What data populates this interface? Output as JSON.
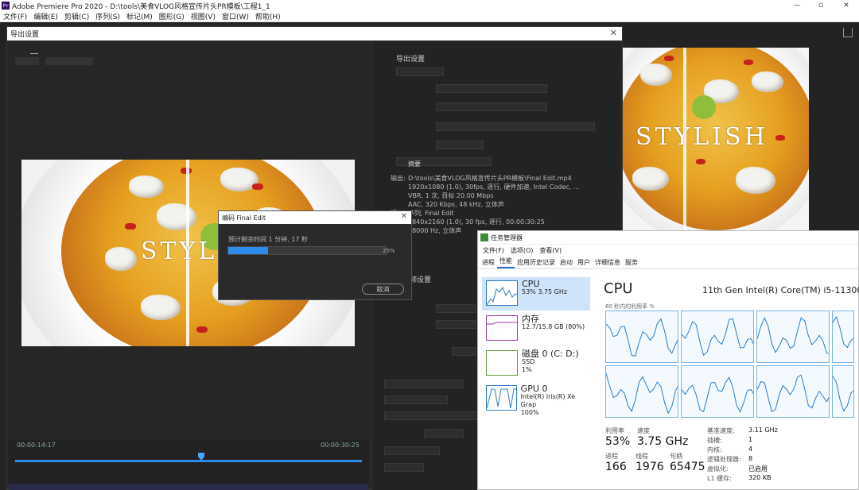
{
  "premiere": {
    "title": "Adobe Premiere Pro 2020 - D:\\tools\\美食VLOG风格宣传片头PR模板\\工程1_1",
    "menu": [
      "文件(F)",
      "编辑(E)",
      "剪辑(C)",
      "序列(S)",
      "标记(M)",
      "图形(G)",
      "视图(V)",
      "窗口(W)",
      "帮助(H)"
    ]
  },
  "export_dialog": {
    "title": "导出设置",
    "settings_title": "导出设置",
    "summary_label": "摘要",
    "output_label": "输出:",
    "output_lines": [
      "D:\\tools\\美食VLOG风格宣传片头PR模板\\Final Edit.mp4",
      "1920x1080 (1.0), 30fps, 逐行, 硬件加速, Intel Codec, ...",
      "VBR, 1 次, 目标 20.00 Mbps",
      "AAC, 320 Kbps, 48 kHz, 立体声"
    ],
    "source_label": "源:",
    "source_lines": [
      "序列, Final Edit",
      "3840x2160 (1.0), 30 fps, 逐行, 00:00:30:25",
      "48000 Hz, 立体声"
    ],
    "video_settings_title": "视频设置",
    "timecode_in": "00:00:14:17",
    "timecode_out": "00:00:30:25",
    "overlay_text": "STYLISH"
  },
  "encoding": {
    "title": "编码 Final Edit",
    "remaining": "预计剩余时间 1 分钟, 17 秒",
    "progress": 25,
    "progress_label": "25%",
    "cancel_label": "取消"
  },
  "task_manager": {
    "title": "任务管理器",
    "menu": [
      "文件(F)",
      "选项(O)",
      "查看(V)"
    ],
    "tabs": [
      "进程",
      "性能",
      "应用历史记录",
      "启动",
      "用户",
      "详细信息",
      "服务"
    ],
    "active_tab": "性能",
    "sidebar": [
      {
        "name": "CPU",
        "sub1": "53% 3.75 GHz",
        "sub2": ""
      },
      {
        "name": "内存",
        "sub1": "12.7/15.8 GB (80%)",
        "sub2": ""
      },
      {
        "name": "磁盘 0 (C: D:)",
        "sub1": "SSD",
        "sub2": "1%"
      },
      {
        "name": "GPU 0",
        "sub1": "Intel(R) Iris(R) Xe Grap",
        "sub2": "100%"
      }
    ],
    "cpu_title": "CPU",
    "cpu_model": "11th Gen Intel(R) Core(TM) i5-11300H",
    "graph_caption": "60 秒内的利用率 %",
    "stats": {
      "util_label": "利用率",
      "util_value": "53%",
      "speed_label": "速度",
      "speed_value": "3.75 GHz",
      "proc_label": "进程",
      "proc_value": "166",
      "thread_label": "线程",
      "thread_value": "1976",
      "handle_label": "句柄",
      "handle_value": "65475"
    },
    "kv": [
      {
        "k": "基准速度:",
        "v": "3.11 GHz"
      },
      {
        "k": "插槽:",
        "v": "1"
      },
      {
        "k": "内核:",
        "v": "4"
      },
      {
        "k": "逻辑处理器:",
        "v": "8"
      },
      {
        "k": "虚拟化:",
        "v": "已启用"
      },
      {
        "k": "L1 缓存:",
        "v": "320 KB"
      }
    ]
  },
  "colors": {
    "accent": "#2d8ceb",
    "dark_bg": "#232323",
    "tm_cpu": "#2a7ec8",
    "tm_mem": "#a23aa8",
    "tm_disk": "#5fa040"
  }
}
